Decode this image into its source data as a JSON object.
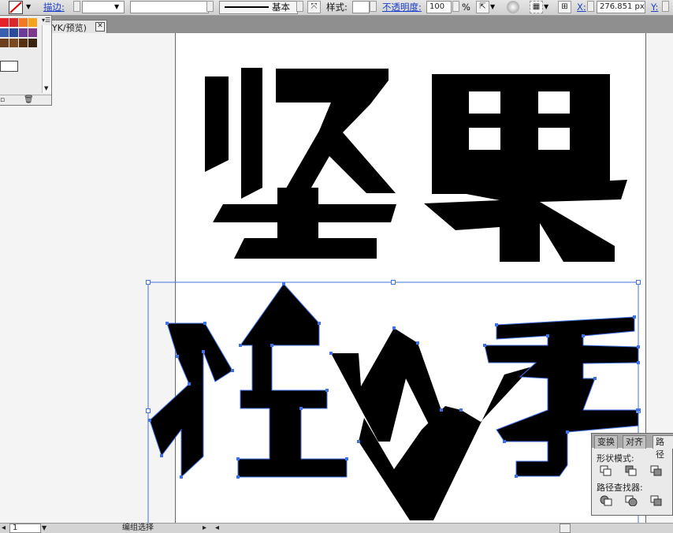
{
  "control_bar": {
    "stroke_label": "描边:",
    "line_style_label": "基本",
    "style_label": "样式:",
    "opacity_label": "不透明度:",
    "opacity_value": "100",
    "opacity_unit": "%",
    "x_label": "X:",
    "x_value": "276.851 px",
    "y_label": "Y:"
  },
  "document_tab": {
    "label": "YK/预览)"
  },
  "pathfinder": {
    "tabs": [
      "变换",
      "对齐",
      "路径"
    ],
    "shape_modes_label": "形状模式:",
    "pathfinders_label": "路径查找器:"
  },
  "status_bar": {
    "page_value": "1",
    "tool_label": "编组选择"
  },
  "swatch_colors": [
    "#e8202a",
    "#d8282e",
    "#ef7a22",
    "#f3a51f",
    "#3a5fb0",
    "#2a4a9c",
    "#6a3c98",
    "#7d3a8c",
    "#6e3f1e",
    "#7c4a22",
    "#563010",
    "#3a2410"
  ],
  "icons": [
    "no-fill-icon",
    "stroke-swatch-icon",
    "panel-menu-icon",
    "transform-icon",
    "recolor-icon",
    "grid-icon",
    "align-icon",
    "select-similar-icon"
  ]
}
